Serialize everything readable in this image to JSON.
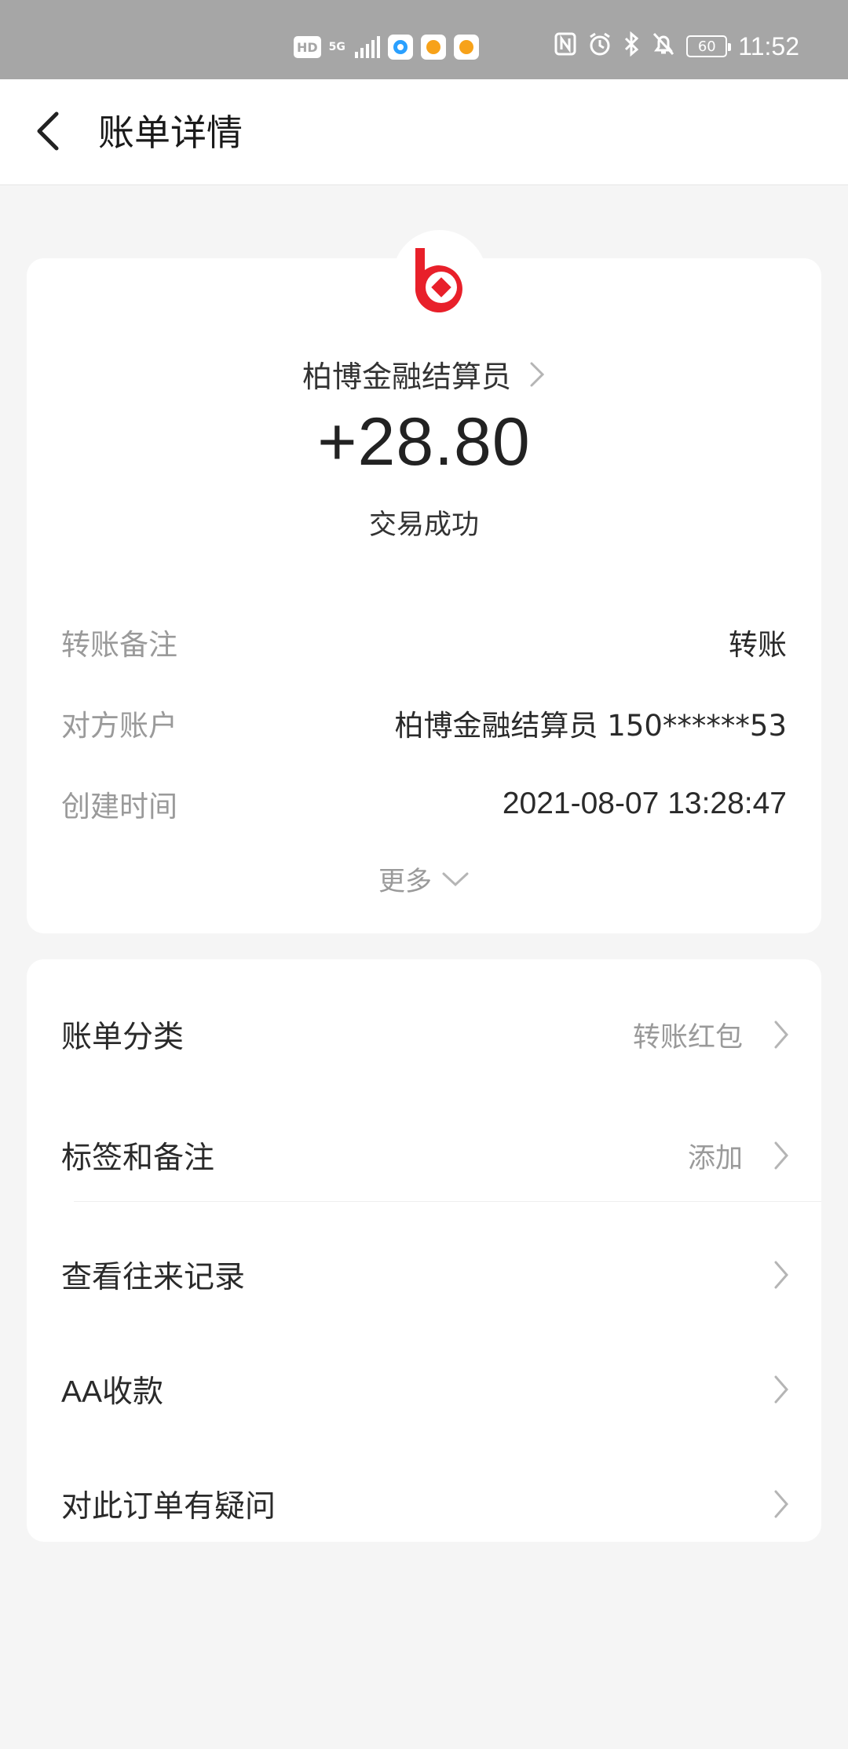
{
  "status_bar": {
    "hd": "HD",
    "network": "5G",
    "battery": "60",
    "time": "11:52",
    "icons": [
      "nfc-icon",
      "alarm-icon",
      "bluetooth-icon",
      "mute-icon"
    ]
  },
  "header": {
    "title": "账单详情",
    "back_icon": "chevron-left-icon"
  },
  "summary": {
    "merchant": "柏博金融结算员",
    "amount": "+28.80",
    "status": "交易成功",
    "brand_color": "#e8202a",
    "details": [
      {
        "label": "转账备注",
        "value": "转账"
      },
      {
        "label": "对方账户",
        "value": "柏博金融结算员 150******53"
      },
      {
        "label": "创建时间",
        "value": "2021-08-07 13:28:47"
      }
    ],
    "more_label": "更多"
  },
  "menu": [
    {
      "label": "账单分类",
      "value": "转账红包"
    },
    {
      "label": "标签和备注",
      "value": "添加"
    },
    {
      "label": "查看往来记录",
      "value": ""
    },
    {
      "label": "AA收款",
      "value": ""
    },
    {
      "label": "对此订单有疑问",
      "value": ""
    }
  ]
}
